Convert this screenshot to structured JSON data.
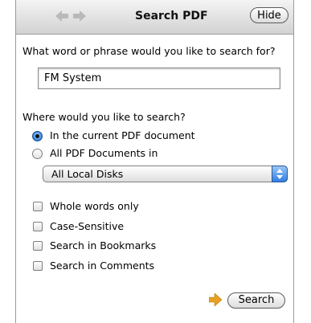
{
  "header": {
    "title": "Search PDF",
    "hide_label": "Hide"
  },
  "query": {
    "prompt": "What word or phrase would you like to search for?",
    "value": "FM System"
  },
  "location": {
    "prompt": "Where would you like to search?",
    "options": [
      {
        "label": "In the current PDF document",
        "selected": true
      },
      {
        "label": "All PDF Documents in",
        "selected": false
      }
    ],
    "scope_value": "All Local Disks"
  },
  "options": [
    {
      "label": "Whole words only",
      "checked": false
    },
    {
      "label": "Case-Sensitive",
      "checked": false
    },
    {
      "label": "Search in Bookmarks",
      "checked": false
    },
    {
      "label": "Search in Comments",
      "checked": false
    }
  ],
  "actions": {
    "search_label": "Search"
  },
  "colors": {
    "accent": "#3a8be3",
    "arrow": "#e8a021"
  }
}
